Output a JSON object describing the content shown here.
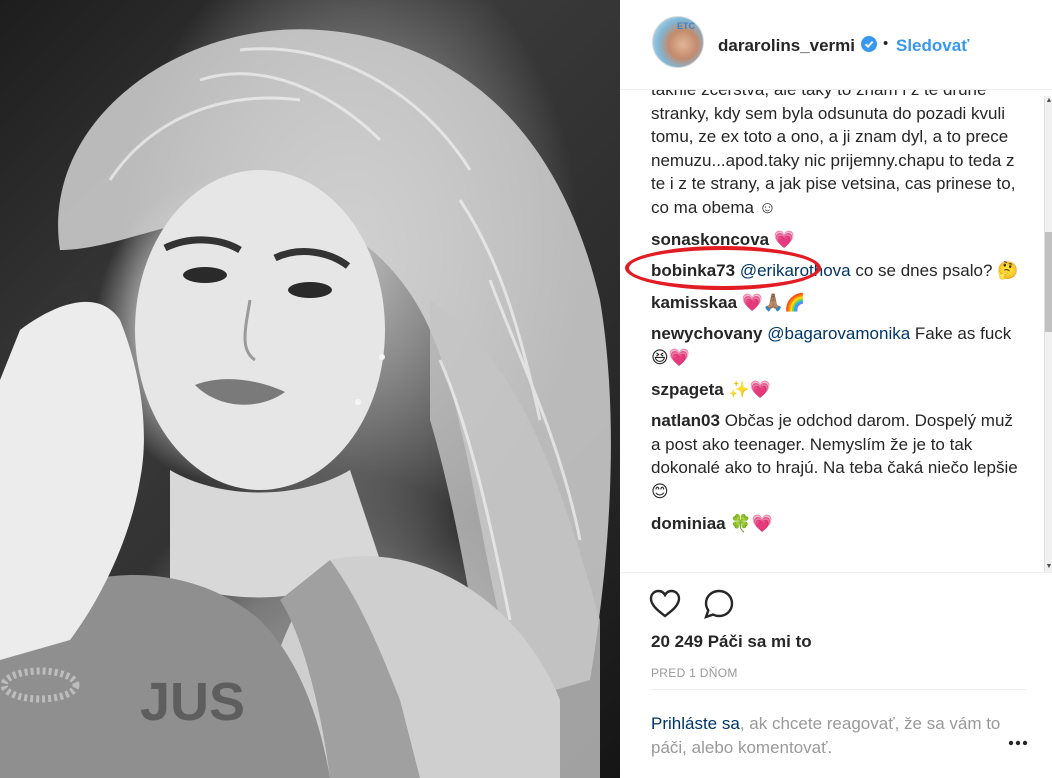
{
  "header": {
    "username": "dararolins_vermi",
    "separator": "•",
    "follow_label": "Sledovať",
    "avatar_mark": "ETC"
  },
  "comments": {
    "caption_tail": "taknie zcerstva, ale taky to znam i z te druhe stranky, kdy sem byla odsunuta do pozadi kvuli tomu, ze ex toto a ono, a ji znam dyl, a to prece nemuzu...apod.taky nic prijemny.chapu to teda z te i z te strany, a jak pise vetsina, cas prinese to, co ma obema ☺",
    "items": [
      {
        "user": "sonaskoncova",
        "text": "💗"
      },
      {
        "user": "bobinka73",
        "mention": "@erikarothova",
        "text": " co se dnes psalo? 🤔"
      },
      {
        "user": "kamisskaa",
        "text": "💗🙏🏽🌈"
      },
      {
        "user": "newychovany",
        "mention": "@bagarovamonika",
        "text": " Fake as fuck😆💗"
      },
      {
        "user": "szpageta",
        "text": "✨💗"
      },
      {
        "user": "natlan03",
        "text": "Občas je odchod darom. Dospelý muž a post ako teenager. Nemyslím že je to tak dokonalé ako to hrajú. Na teba čaká niečo lepšie 😊"
      },
      {
        "user": "dominiaa",
        "text": "🍀💗"
      }
    ]
  },
  "actions": {
    "like_icon": "heart-outline-icon",
    "comment_icon": "speech-bubble-icon",
    "likes_text": "20 249 Páči sa mi to",
    "time_text": "PRED 1 DŇOM"
  },
  "footer": {
    "login_link": "Prihláste sa",
    "login_rest": ", ak chcete reagovať, že sa vám to páči, alebo komentovať."
  },
  "colors": {
    "link_blue": "#3897f0",
    "mention_navy": "#003569",
    "annotation_red": "#e31b23",
    "muted_gray": "#999999"
  }
}
